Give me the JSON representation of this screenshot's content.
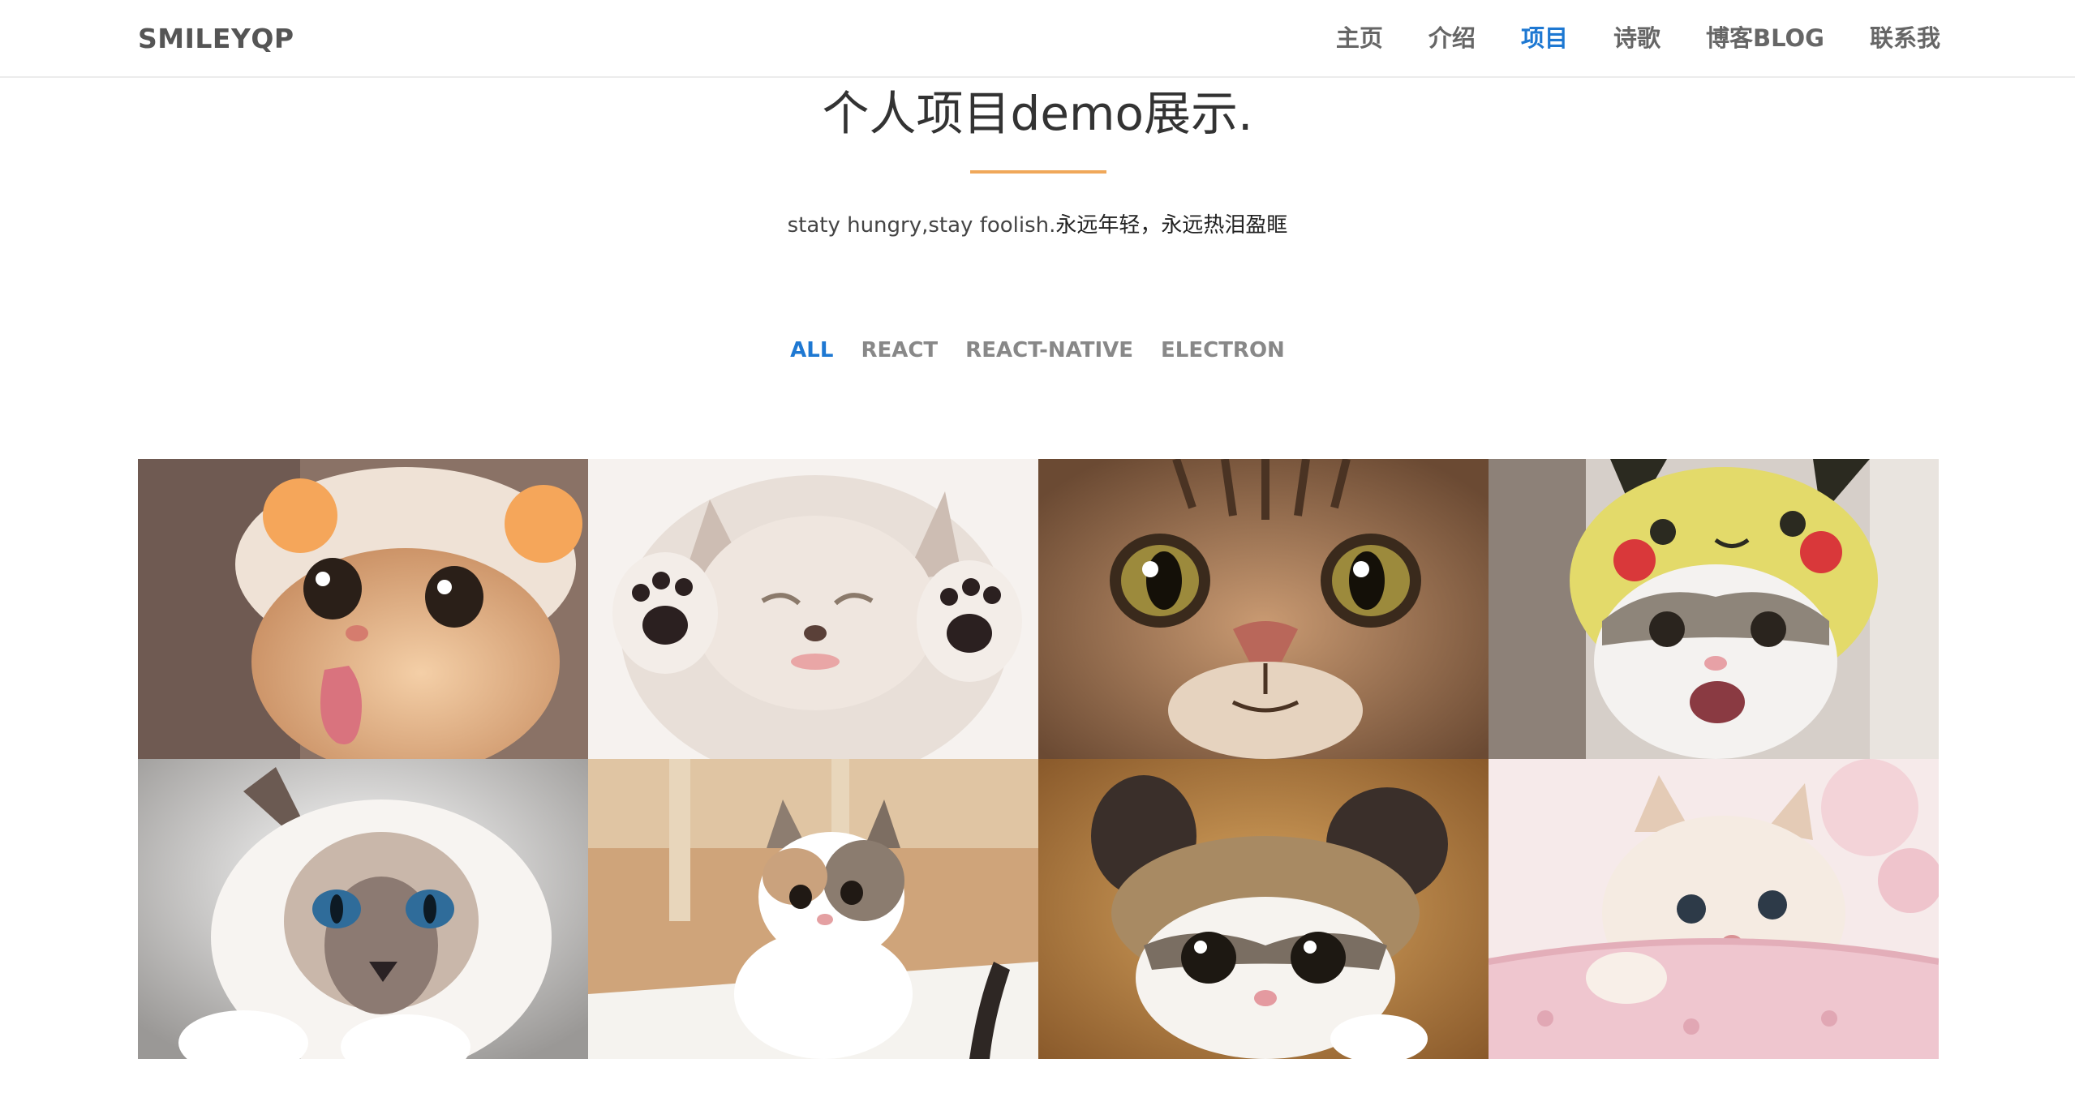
{
  "navbar": {
    "brand": "SMILEYQP",
    "links": [
      {
        "label": "主页",
        "active": false
      },
      {
        "label": "介绍",
        "active": false
      },
      {
        "label": "项目",
        "active": true
      },
      {
        "label": "诗歌",
        "active": false
      },
      {
        "label": "博客BLOG",
        "active": false
      },
      {
        "label": "联系我",
        "active": false
      }
    ]
  },
  "section": {
    "title": "个人项目demo展示.",
    "subtitle_en": "staty hungry,stay foolish.",
    "subtitle_cn": "永远年轻，永远热泪盈眶"
  },
  "filters": [
    {
      "label": "ALL",
      "active": true
    },
    {
      "label": "REACT",
      "active": false
    },
    {
      "label": "REACT-NATIVE",
      "active": false
    },
    {
      "label": "ELECTRON",
      "active": false
    }
  ],
  "colors": {
    "accent": "#1e78d2",
    "underline": "#f0a85a",
    "nav_text": "#666666"
  },
  "gallery": {
    "items": [
      {
        "icon": "cat-in-bear-hat-tongue-photo"
      },
      {
        "icon": "fluffy-kitten-paws-up-photo"
      },
      {
        "icon": "tabby-cat-closeup-photo"
      },
      {
        "icon": "kitten-in-pikachu-hat-photo"
      },
      {
        "icon": "ragdoll-cat-blue-eyes-photo"
      },
      {
        "icon": "calico-kitten-looking-up-photo"
      },
      {
        "icon": "cat-in-bear-ears-hat-photo"
      },
      {
        "icon": "kitten-in-pink-cup-photo"
      }
    ]
  }
}
